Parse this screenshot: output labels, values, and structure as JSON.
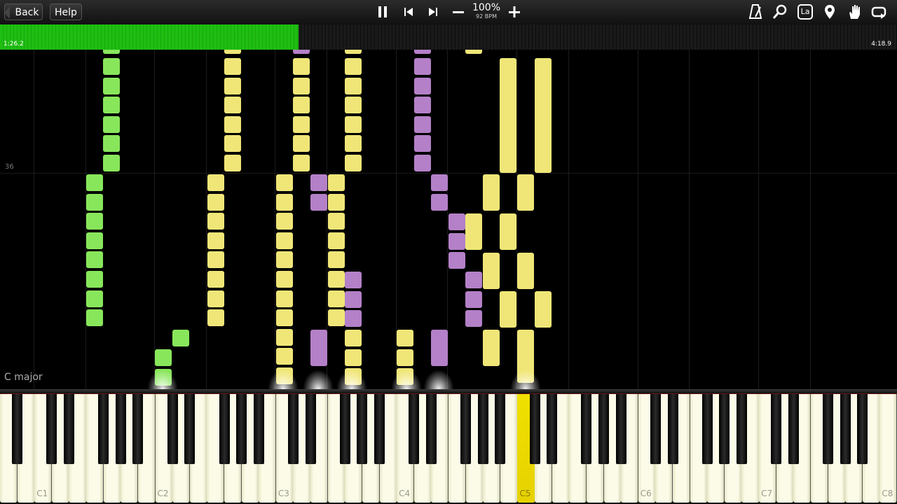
{
  "toolbar": {
    "back_label": "Back",
    "help_label": "Help",
    "speed_percent": "100%",
    "speed_bpm": "92 BPM",
    "icons": [
      "pause-icon",
      "skip-back-icon",
      "skip-forward-icon",
      "minus-icon",
      "plus-icon",
      "metronome-icon",
      "search-icon",
      "label-icon",
      "location-pin-icon",
      "hand-icon",
      "loop-icon"
    ],
    "label_icon_text": "La"
  },
  "progress": {
    "current_time": "1:26.2",
    "total_time": "4:18.9",
    "fraction": 0.333,
    "fill_color": "#1fbe12"
  },
  "roll": {
    "measure_number": "36",
    "key_signature": "C major"
  },
  "keyboard": {
    "octave_labels": [
      "C1",
      "C2",
      "C3",
      "C4",
      "C5",
      "C6",
      "C7",
      "C8"
    ],
    "active_key": "C5",
    "active_color": "#f0e000"
  },
  "colors": {
    "green": "#88e65b",
    "yellow": "#f0e678",
    "purple": "#b480c8"
  }
}
